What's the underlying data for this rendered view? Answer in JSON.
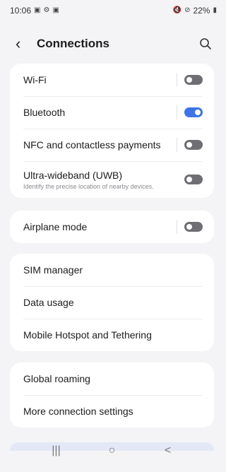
{
  "status_bar": {
    "time": "10:06",
    "left_icons": [
      "gallery-icon",
      "settings-icon",
      "image-icon"
    ],
    "right_icons": [
      "mute-icon",
      "dnd-icon"
    ],
    "battery": "22%"
  },
  "header": {
    "title": "Connections"
  },
  "groups": [
    {
      "items": [
        {
          "label": "Wi-Fi",
          "toggle": "off"
        },
        {
          "label": "Bluetooth",
          "toggle": "on"
        },
        {
          "label": "NFC and contactless payments",
          "toggle": "off"
        },
        {
          "label": "Ultra-wideband (UWB)",
          "sublabel": "Identify the precise location of nearby devices.",
          "toggle": "off"
        }
      ]
    },
    {
      "items": [
        {
          "label": "Airplane mode",
          "toggle": "off"
        }
      ]
    },
    {
      "items": [
        {
          "label": "SIM manager"
        },
        {
          "label": "Data usage"
        },
        {
          "label": "Mobile Hotspot and Tethering"
        }
      ]
    },
    {
      "items": [
        {
          "label": "Global roaming"
        },
        {
          "label": "More connection settings"
        }
      ]
    }
  ],
  "nav_bar": {
    "recents": "|||",
    "home": "○",
    "back": "<"
  },
  "colors": {
    "accent": "#3e74e6",
    "background": "#f4f4f6",
    "card": "#ffffff"
  }
}
